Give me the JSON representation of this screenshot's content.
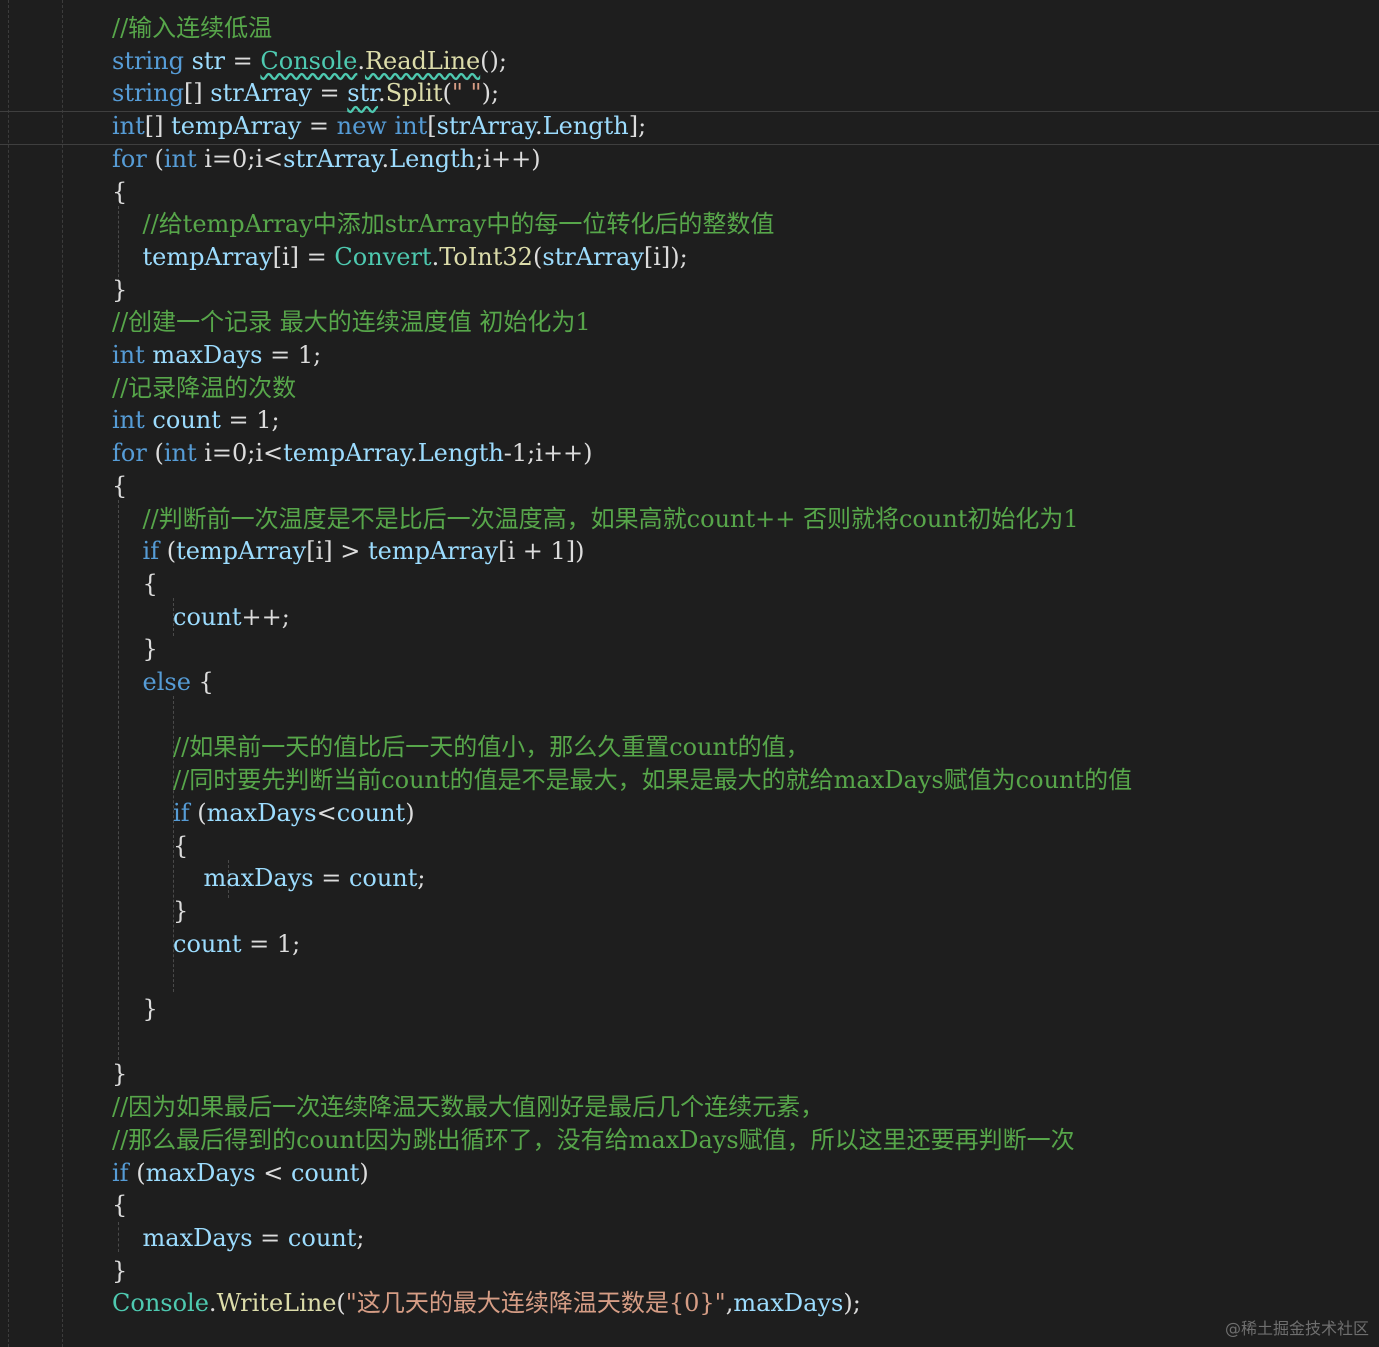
{
  "colors": {
    "background": "#1e1e1e",
    "keyword": "#569cd6",
    "type": "#4ec9b0",
    "comment": "#57a64a",
    "string": "#d69d85",
    "identifier": "#9cdcfe",
    "method": "#dcdcaa",
    "plain": "#dcdcdc"
  },
  "lines": [
    [
      [
        "cm",
        "//输入连续低温"
      ]
    ],
    [
      [
        "kw",
        "string"
      ],
      [
        "pl",
        " "
      ],
      [
        "id",
        "str"
      ],
      [
        "pl",
        " = "
      ],
      [
        "ty",
        "Console"
      ],
      [
        "pl",
        "."
      ],
      [
        "fn",
        "ReadLine"
      ],
      [
        "pl",
        "();"
      ]
    ],
    [
      [
        "kw",
        "string"
      ],
      [
        "pl",
        "[] "
      ],
      [
        "id",
        "strArray"
      ],
      [
        "pl",
        " = "
      ],
      [
        "id",
        "str"
      ],
      [
        "pl",
        "."
      ],
      [
        "fn",
        "Split"
      ],
      [
        "pl",
        "("
      ],
      [
        "str",
        "\" \""
      ],
      [
        "pl",
        ");"
      ]
    ],
    [
      [
        "kw",
        "int"
      ],
      [
        "pl",
        "[] "
      ],
      [
        "id",
        "tempArray"
      ],
      [
        "pl",
        " = "
      ],
      [
        "kw",
        "new"
      ],
      [
        "pl",
        " "
      ],
      [
        "kw",
        "int"
      ],
      [
        "pl",
        "["
      ],
      [
        "id",
        "strArray"
      ],
      [
        "pl",
        "."
      ],
      [
        "id",
        "Length"
      ],
      [
        "pl",
        "];"
      ]
    ],
    [
      [
        "kw",
        "for"
      ],
      [
        "pl",
        " ("
      ],
      [
        "kw",
        "int"
      ],
      [
        "pl",
        " i=0;i<"
      ],
      [
        "id",
        "strArray"
      ],
      [
        "pl",
        "."
      ],
      [
        "id",
        "Length"
      ],
      [
        "pl",
        ";i++)"
      ]
    ],
    [
      [
        "pl",
        "{"
      ]
    ],
    [
      [
        "pl",
        "    "
      ],
      [
        "cm",
        "//给tempArray中添加strArray中的每一位转化后的整数值"
      ]
    ],
    [
      [
        "pl",
        "    "
      ],
      [
        "id",
        "tempArray"
      ],
      [
        "pl",
        "[i] = "
      ],
      [
        "ty",
        "Convert"
      ],
      [
        "pl",
        "."
      ],
      [
        "fn",
        "ToInt32"
      ],
      [
        "pl",
        "("
      ],
      [
        "id",
        "strArray"
      ],
      [
        "pl",
        "[i]);"
      ]
    ],
    [
      [
        "pl",
        "}"
      ]
    ],
    [
      [
        "cm",
        "//创建一个记录 最大的连续温度值 初始化为1"
      ]
    ],
    [
      [
        "kw",
        "int"
      ],
      [
        "pl",
        " "
      ],
      [
        "id",
        "maxDays"
      ],
      [
        "pl",
        " = 1;"
      ]
    ],
    [
      [
        "cm",
        "//记录降温的次数"
      ]
    ],
    [
      [
        "kw",
        "int"
      ],
      [
        "pl",
        " "
      ],
      [
        "id",
        "count"
      ],
      [
        "pl",
        " = 1;"
      ]
    ],
    [
      [
        "kw",
        "for"
      ],
      [
        "pl",
        " ("
      ],
      [
        "kw",
        "int"
      ],
      [
        "pl",
        " i=0;i<"
      ],
      [
        "id",
        "tempArray"
      ],
      [
        "pl",
        "."
      ],
      [
        "id",
        "Length"
      ],
      [
        "pl",
        "-1;i++)"
      ]
    ],
    [
      [
        "pl",
        "{"
      ]
    ],
    [
      [
        "pl",
        "    "
      ],
      [
        "cm",
        "//判断前一次温度是不是比后一次温度高，如果高就count++ 否则就将count初始化为1"
      ]
    ],
    [
      [
        "pl",
        "    "
      ],
      [
        "kw",
        "if"
      ],
      [
        "pl",
        " ("
      ],
      [
        "id",
        "tempArray"
      ],
      [
        "pl",
        "[i] > "
      ],
      [
        "id",
        "tempArray"
      ],
      [
        "pl",
        "[i + 1])"
      ]
    ],
    [
      [
        "pl",
        "    {"
      ]
    ],
    [
      [
        "pl",
        "        "
      ],
      [
        "id",
        "count"
      ],
      [
        "pl",
        "++;"
      ]
    ],
    [
      [
        "pl",
        "    }"
      ]
    ],
    [
      [
        "pl",
        "    "
      ],
      [
        "kw",
        "else"
      ],
      [
        "pl",
        " {"
      ]
    ],
    [],
    [
      [
        "pl",
        "        "
      ],
      [
        "cm",
        "//如果前一天的值比后一天的值小，那么久重置count的值，"
      ]
    ],
    [
      [
        "pl",
        "        "
      ],
      [
        "cm",
        "//同时要先判断当前count的值是不是最大，如果是最大的就给maxDays赋值为count的值"
      ]
    ],
    [
      [
        "pl",
        "        "
      ],
      [
        "kw",
        "if"
      ],
      [
        "pl",
        " ("
      ],
      [
        "id",
        "maxDays"
      ],
      [
        "pl",
        "<"
      ],
      [
        "id",
        "count"
      ],
      [
        "pl",
        ")"
      ]
    ],
    [
      [
        "pl",
        "        {"
      ]
    ],
    [
      [
        "pl",
        "            "
      ],
      [
        "id",
        "maxDays"
      ],
      [
        "pl",
        " = "
      ],
      [
        "id",
        "count"
      ],
      [
        "pl",
        ";"
      ]
    ],
    [
      [
        "pl",
        "        }"
      ]
    ],
    [
      [
        "pl",
        "        "
      ],
      [
        "id",
        "count"
      ],
      [
        "pl",
        " = 1;"
      ]
    ],
    [],
    [
      [
        "pl",
        "    }"
      ]
    ],
    [],
    [
      [
        "pl",
        "}"
      ]
    ],
    [
      [
        "cm",
        "//因为如果最后一次连续降温天数最大值刚好是最后几个连续元素，"
      ]
    ],
    [
      [
        "cm",
        "//那么最后得到的count因为跳出循环了，没有给maxDays赋值，所以这里还要再判断一次"
      ]
    ],
    [
      [
        "kw",
        "if"
      ],
      [
        "pl",
        " ("
      ],
      [
        "id",
        "maxDays"
      ],
      [
        "pl",
        " < "
      ],
      [
        "id",
        "count"
      ],
      [
        "pl",
        ")"
      ]
    ],
    [
      [
        "pl",
        "{"
      ]
    ],
    [
      [
        "pl",
        "    "
      ],
      [
        "id",
        "maxDays"
      ],
      [
        "pl",
        " = "
      ],
      [
        "id",
        "count"
      ],
      [
        "pl",
        ";"
      ]
    ],
    [
      [
        "pl",
        "}"
      ]
    ],
    [
      [
        "ty",
        "Console"
      ],
      [
        "pl",
        "."
      ],
      [
        "fn",
        "WriteLine"
      ],
      [
        "pl",
        "("
      ],
      [
        "str",
        "\"这几天的最大连续降温天数是{0}\""
      ],
      [
        "pl",
        ","
      ],
      [
        "id",
        "maxDays"
      ],
      [
        "pl",
        ");"
      ]
    ]
  ],
  "watermark": "@稀土掘金技术社区"
}
